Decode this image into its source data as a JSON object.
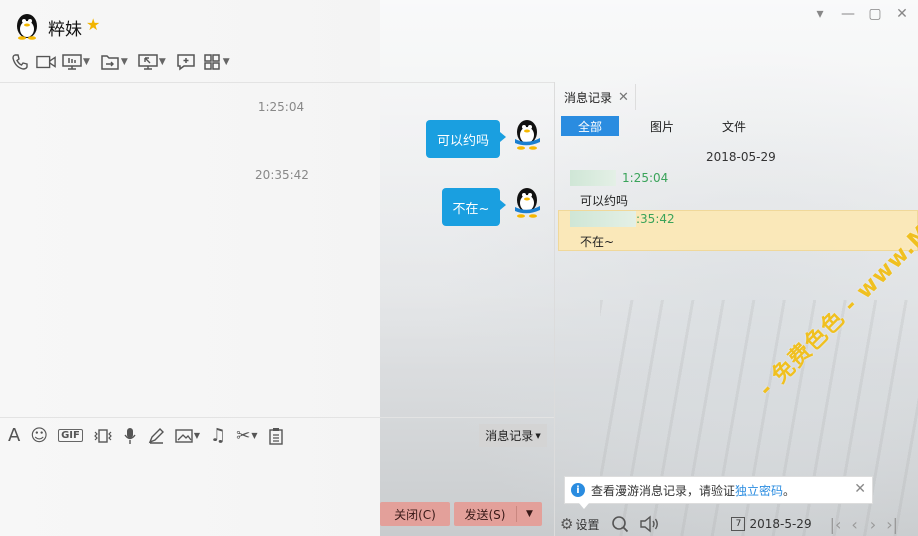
{
  "window": {
    "contact_name": "粹妹",
    "controls": [
      "minimize-icon",
      "restore-icon",
      "maximize-icon",
      "close-icon"
    ]
  },
  "toolbar": {
    "items": [
      "phone-icon",
      "video-icon",
      "screen-share-icon",
      "file-transfer-icon",
      "remote-desktop-icon",
      "add-chat-icon",
      "apps-icon"
    ]
  },
  "chat": {
    "messages": [
      {
        "time": "1:25:04",
        "text": "可以约吗"
      },
      {
        "time": "20:35:42",
        "text": "不在~"
      }
    ]
  },
  "input_toolbar": {
    "gif_label": "GIF",
    "history_button": "消息记录"
  },
  "buttons": {
    "close": "关闭(C)",
    "send": "发送(S)"
  },
  "history": {
    "tab_label": "消息记录",
    "filters": [
      "全部",
      "图片",
      "文件"
    ],
    "date": "2018-05-29",
    "entries": [
      {
        "time": "1:25:04",
        "text": "可以约吗"
      },
      {
        "time": ":35:42",
        "text": "不在~"
      }
    ],
    "notice_text": "查看漫游消息记录，请验证",
    "notice_link": "独立密码",
    "notice_end": "。",
    "settings_label": "设置",
    "calendar_day": "7",
    "bottom_date": "2018-5-29"
  },
  "watermark": "- 免费色色 - www.MFsese.com",
  "colors": {
    "bubble": "#1a9fe0",
    "accent": "#2a8ce0",
    "button": "#e3a09a",
    "highlight": "#fce8b4"
  }
}
